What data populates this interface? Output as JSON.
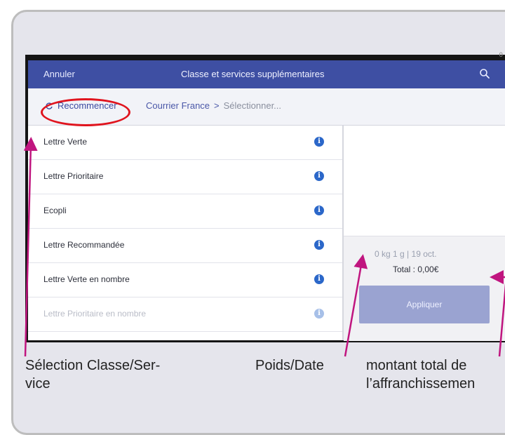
{
  "colors": {
    "accent": "#3e4fa3",
    "info": "#2b67c9",
    "highlight": "#e0141e",
    "arrow": "#c0157f",
    "apply_button": "#9aa3d1"
  },
  "statusbar": {
    "mark": "0 ▪"
  },
  "navbar": {
    "cancel_label": "Annuler",
    "title": "Classe et services supplémentaires",
    "search_icon": "search-icon"
  },
  "breadcrumb": {
    "restart_icon": "refresh-icon",
    "restart_label": "Recommencer",
    "items": [
      "Courrier France",
      "Sélectionner..."
    ],
    "separator": ">"
  },
  "classes": [
    {
      "label": "Lettre Verte"
    },
    {
      "label": "Lettre Prioritaire"
    },
    {
      "label": "Ecopli"
    },
    {
      "label": "Lettre Recommandée"
    },
    {
      "label": "Lettre Verte en nombre"
    },
    {
      "label": "Lettre Prioritaire en nombre"
    }
  ],
  "info_icon": {
    "name": "info-icon",
    "glyph": "i"
  },
  "summary": {
    "weight": "0 kg 1 g",
    "separator": "|",
    "date": "19 oct.",
    "total": "Total : 0,00€",
    "apply_label": "Appliquer"
  },
  "annotations": {
    "selection": "Sélection Classe/Ser-\nvice",
    "weight_date": "Poids/Date",
    "total_amount": "montant total de\nl’affranchissemen"
  }
}
